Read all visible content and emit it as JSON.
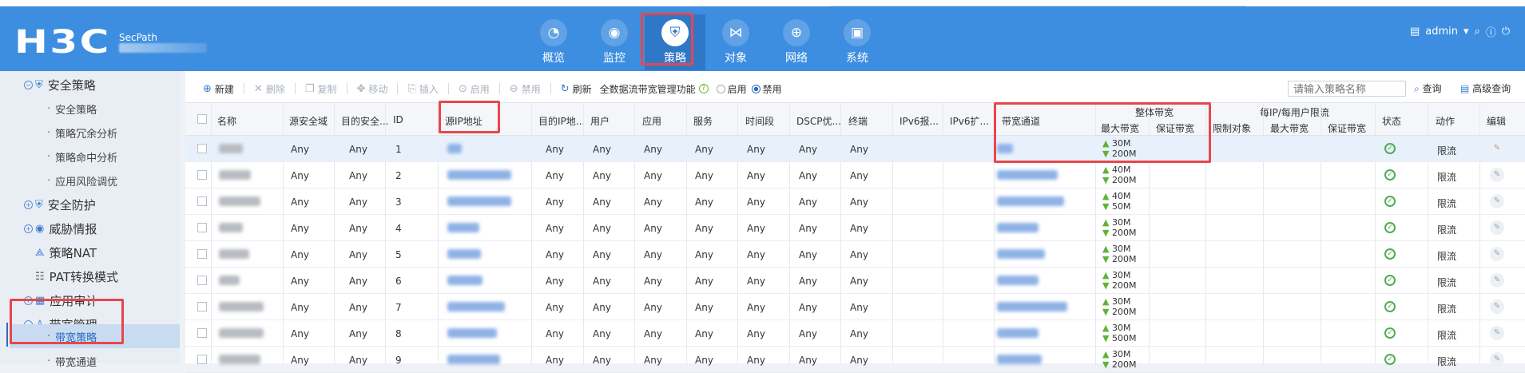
{
  "header": {
    "logo": "H3C",
    "product": "SecPath",
    "nav": [
      {
        "label": "概览",
        "icon": "gauge-icon",
        "glyph": "◔"
      },
      {
        "label": "监控",
        "icon": "monitor-icon",
        "glyph": "◉"
      },
      {
        "label": "策略",
        "icon": "shield-icon",
        "glyph": "⛨"
      },
      {
        "label": "对象",
        "icon": "share-icon",
        "glyph": "⋈"
      },
      {
        "label": "网络",
        "icon": "globe-icon",
        "glyph": "⊕"
      },
      {
        "label": "系统",
        "icon": "computer-icon",
        "glyph": "▣"
      }
    ],
    "user": "admin"
  },
  "sidebar": {
    "groups": [
      {
        "label": "安全策略",
        "icon": "shield-icon"
      },
      {
        "label": "安全策略"
      },
      {
        "label": "策略冗余分析"
      },
      {
        "label": "策略命中分析"
      },
      {
        "label": "应用风险调优"
      },
      {
        "label": "安全防护",
        "icon": "shield-icon"
      },
      {
        "label": "威胁情报",
        "icon": "eye-icon"
      },
      {
        "label": "策略NAT",
        "icon": "nat-icon"
      },
      {
        "label": "PAT转换模式",
        "icon": "pat-icon"
      },
      {
        "label": "应用审计",
        "icon": "grid-icon"
      },
      {
        "label": "带宽管理",
        "icon": "users-icon"
      },
      {
        "label": "带宽策略"
      },
      {
        "label": "带宽通道"
      }
    ]
  },
  "toolbar": {
    "new": "新建",
    "delete": "删除",
    "copy": "复制",
    "move": "移动",
    "insert": "插入",
    "enable": "启用",
    "disable": "禁用",
    "refresh": "刷新",
    "global_label": "全数据流带宽管理功能",
    "radio_enable": "启用",
    "radio_disable": "禁用",
    "search_placeholder": "请输入策略名称",
    "query": "查询",
    "advanced": "高级查询"
  },
  "table": {
    "headers": {
      "name": "名称",
      "src_zone": "源安全域",
      "dst_zone": "目的安全...",
      "id": "ID",
      "src_ip": "源IP地址",
      "dst_ip": "目的IP地...",
      "user": "用户",
      "app": "应用",
      "service": "服务",
      "time": "时间段",
      "dscp": "DSCP优...",
      "terminal": "终端",
      "ipv6_report": "IPv6报...",
      "ipv6_ext": "IPv6扩...",
      "channel": "带宽通道",
      "overall": "整体带宽",
      "max_bw": "最大带宽",
      "guarantee_bw": "保证带宽",
      "per_ip": "每IP/每用户限流",
      "limit_obj": "限制对象",
      "max_bw2": "最大带宽",
      "guarantee_bw2": "保证带宽",
      "status": "状态",
      "action": "动作",
      "edit": "编辑"
    },
    "rows": [
      {
        "id": "1",
        "src_zone": "Any",
        "dst_zone": "Any",
        "dst_ip": "Any",
        "user": "Any",
        "app": "Any",
        "service": "Any",
        "time": "Any",
        "dscp": "Any",
        "terminal": "Any",
        "up": "30M",
        "down": "200M",
        "action": "限流",
        "name_w": 30,
        "ip_w": 18,
        "ch_w": 20
      },
      {
        "id": "2",
        "src_zone": "Any",
        "dst_zone": "Any",
        "dst_ip": "Any",
        "user": "Any",
        "app": "Any",
        "service": "Any",
        "time": "Any",
        "dscp": "Any",
        "terminal": "Any",
        "up": "40M",
        "down": "200M",
        "action": "限流",
        "name_w": 40,
        "ip_w": 80,
        "ch_w": 76
      },
      {
        "id": "3",
        "src_zone": "Any",
        "dst_zone": "Any",
        "dst_ip": "Any",
        "user": "Any",
        "app": "Any",
        "service": "Any",
        "time": "Any",
        "dscp": "Any",
        "terminal": "Any",
        "up": "40M",
        "down": "50M",
        "action": "限流",
        "name_w": 52,
        "ip_w": 80,
        "ch_w": 84
      },
      {
        "id": "4",
        "src_zone": "Any",
        "dst_zone": "Any",
        "dst_ip": "Any",
        "user": "Any",
        "app": "Any",
        "service": "Any",
        "time": "Any",
        "dscp": "Any",
        "terminal": "Any",
        "up": "30M",
        "down": "200M",
        "action": "限流",
        "name_w": 30,
        "ip_w": 40,
        "ch_w": 52
      },
      {
        "id": "5",
        "src_zone": "Any",
        "dst_zone": "Any",
        "dst_ip": "Any",
        "user": "Any",
        "app": "Any",
        "service": "Any",
        "time": "Any",
        "dscp": "Any",
        "terminal": "Any",
        "up": "30M",
        "down": "200M",
        "action": "限流",
        "name_w": 38,
        "ip_w": 42,
        "ch_w": 60
      },
      {
        "id": "6",
        "src_zone": "Any",
        "dst_zone": "Any",
        "dst_ip": "Any",
        "user": "Any",
        "app": "Any",
        "service": "Any",
        "time": "Any",
        "dscp": "Any",
        "terminal": "Any",
        "up": "30M",
        "down": "200M",
        "action": "限流",
        "name_w": 26,
        "ip_w": 44,
        "ch_w": 52
      },
      {
        "id": "7",
        "src_zone": "Any",
        "dst_zone": "Any",
        "dst_ip": "Any",
        "user": "Any",
        "app": "Any",
        "service": "Any",
        "time": "Any",
        "dscp": "Any",
        "terminal": "Any",
        "up": "30M",
        "down": "200M",
        "action": "限流",
        "name_w": 56,
        "ip_w": 72,
        "ch_w": 88
      },
      {
        "id": "8",
        "src_zone": "Any",
        "dst_zone": "Any",
        "dst_ip": "Any",
        "user": "Any",
        "app": "Any",
        "service": "Any",
        "time": "Any",
        "dscp": "Any",
        "terminal": "Any",
        "up": "30M",
        "down": "500M",
        "action": "限流",
        "name_w": 56,
        "ip_w": 62,
        "ch_w": 52
      },
      {
        "id": "9",
        "src_zone": "Any",
        "dst_zone": "Any",
        "dst_ip": "Any",
        "user": "Any",
        "app": "Any",
        "service": "Any",
        "time": "Any",
        "dscp": "Any",
        "terminal": "Any",
        "up": "30M",
        "down": "200M",
        "action": "限流",
        "name_w": 52,
        "ip_w": 66,
        "ch_w": 56
      }
    ]
  },
  "colors": {
    "header_bg": "#3d8ee0",
    "highlight": "#e8464b",
    "status_ok": "#4caf50"
  }
}
